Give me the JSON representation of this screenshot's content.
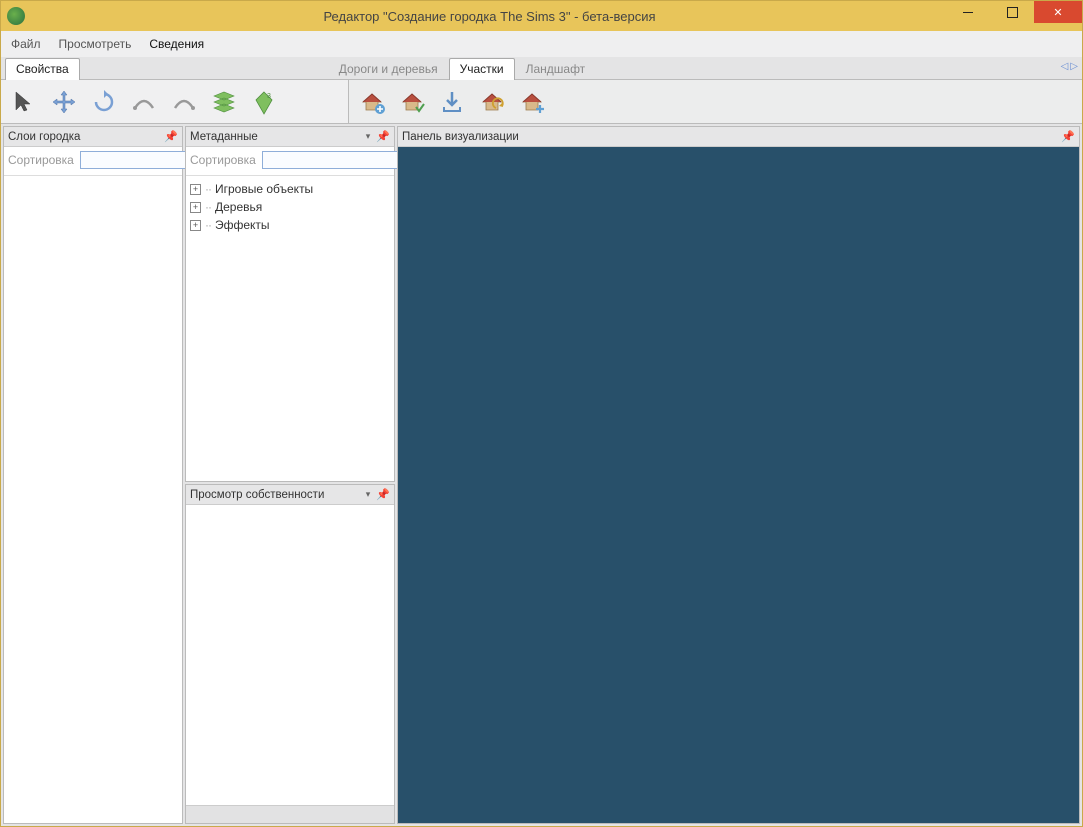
{
  "window": {
    "title": "Редактор \"Создание городка The Sims 3\" - бета-версия"
  },
  "menu": {
    "file": "Файл",
    "view": "Просмотреть",
    "about": "Сведения"
  },
  "tabs": {
    "left": {
      "properties": "Свойства"
    },
    "right": {
      "roads": "Дороги и деревья",
      "lots": "Участки",
      "landscape": "Ландшафт"
    }
  },
  "panels": {
    "layers": {
      "title": "Слои городка",
      "sort_label": "Сортировка"
    },
    "metadata": {
      "title": "Метаданные",
      "sort_label": "Сортировка",
      "tree": {
        "game_objects": "Игровые объекты",
        "trees": "Деревья",
        "effects": "Эффекты"
      }
    },
    "property_view": {
      "title": "Просмотр собственности"
    },
    "viewport": {
      "title": "Панель визуализации"
    }
  }
}
